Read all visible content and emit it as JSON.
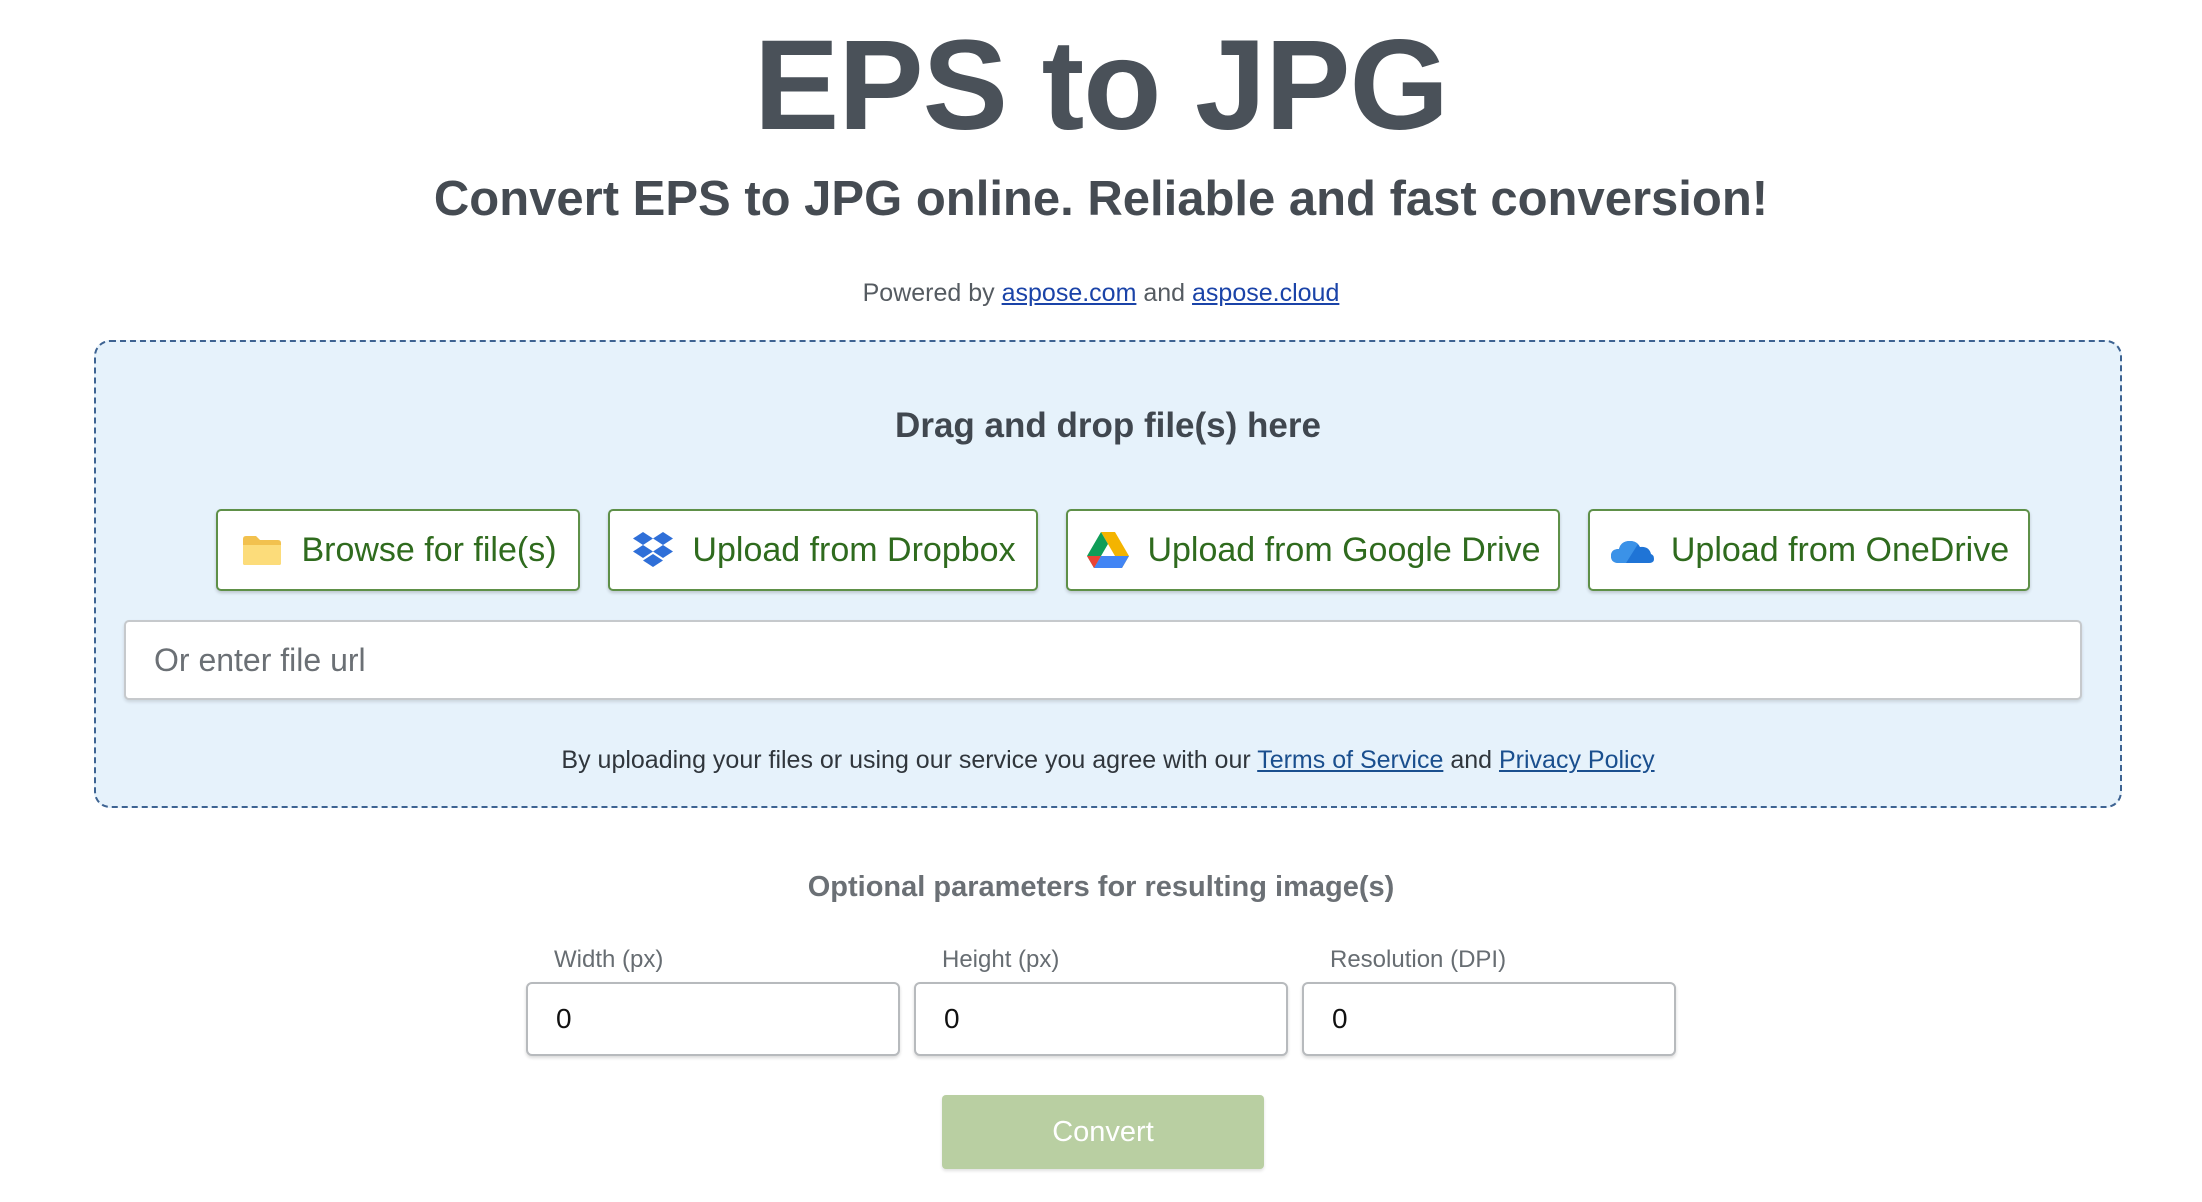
{
  "header": {
    "title": "EPS to JPG",
    "subtitle": "Convert EPS to JPG online. Reliable and fast conversion!",
    "powered_prefix": "Powered by",
    "powered_link1": "aspose.com",
    "powered_and": "and",
    "powered_link2": "aspose.cloud"
  },
  "dropzone": {
    "title": "Drag and drop file(s) here",
    "buttons": [
      {
        "label": "Browse for file(s)",
        "icon": "folder-icon"
      },
      {
        "label": "Upload from Dropbox",
        "icon": "dropbox-icon"
      },
      {
        "label": "Upload from Google Drive",
        "icon": "google-drive-icon"
      },
      {
        "label": "Upload from OneDrive",
        "icon": "onedrive-icon"
      }
    ],
    "url_placeholder": "Or enter file url",
    "url_value": "",
    "agree_prefix": "By uploading your files or using our service you agree with our",
    "terms_link": "Terms of Service",
    "agree_and": "and",
    "privacy_link": "Privacy Policy"
  },
  "params": {
    "title": "Optional parameters for resulting image(s)",
    "fields": [
      {
        "label": "Width (px)",
        "value": "0"
      },
      {
        "label": "Height (px)",
        "value": "0"
      },
      {
        "label": "Resolution (DPI)",
        "value": "0"
      }
    ]
  },
  "convert": {
    "label": "Convert"
  },
  "colors": {
    "accent_green": "#2f6b1e",
    "dropzone_bg": "#e6f2fb",
    "convert_disabled": "#b9cfa2",
    "link_blue": "#1a43a8"
  }
}
